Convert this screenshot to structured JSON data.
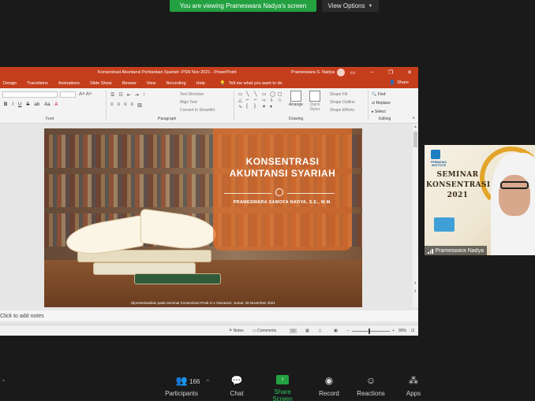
{
  "zoom_bar": {
    "banner": "You are viewing Prameswara Nadya's screen",
    "view_options": "View Options"
  },
  "ppt": {
    "doc_title": "Konsentrasi Akuntansi Perbankan Syariah -PSN Nov 2021  -  PowerPoint",
    "user": "Prameswara S. Nadya",
    "menu": [
      "Design",
      "Transitions",
      "Animations",
      "Slide Show",
      "Review",
      "View",
      "Recording",
      "Help"
    ],
    "tell_me": "Tell me what you want to do",
    "share": "Share",
    "ribbon": {
      "font_group": "Font",
      "paragraph_group": "Paragraph",
      "drawing_group": "Drawing",
      "editing_group": "Editing",
      "text_direction": "Text Direction",
      "align_text": "Align Text",
      "convert_smartart": "Convert to SmartArt",
      "arrange": "Arrange",
      "quick_styles": "Quick Styles",
      "shape_fill": "Shape Fill",
      "shape_outline": "Shape Outline",
      "shape_effects": "Shape Effects",
      "find": "Find",
      "replace": "Replace",
      "select": "Select"
    },
    "slide": {
      "title_line1": "KONSENTRASI",
      "title_line2": "AKUNTANSI SYARIAH",
      "presenter": "PRAMESWARA SAMOFA NADYA, S.E., M.M.",
      "caption": "Dipresentasikan pada Seminar Konsentrasi Prodi S-1 Akuntansi, Jumat, 26 November 2021"
    },
    "notes_placeholder": "Click to add notes",
    "status": {
      "notes": "Notes",
      "comments": "Comments",
      "zoom": "90%",
      "zoom_fraction": 0.9
    }
  },
  "camera": {
    "institute": "PERBANAS INSTITUTE",
    "seminar_line1": "SEMINAR",
    "seminar_line2": "KONSENTRASI",
    "seminar_line3": "2021",
    "name": "Prameswara Nadya"
  },
  "toolbar": {
    "participants_count": "166",
    "participants": "Participants",
    "chat": "Chat",
    "share_screen": "Share Screen",
    "record": "Record",
    "reactions": "Reactions",
    "apps": "Apps"
  },
  "colors": {
    "zoom_green": "#23a141",
    "ppt_red": "#c43e1c",
    "slide_orange": "#e06c28"
  }
}
